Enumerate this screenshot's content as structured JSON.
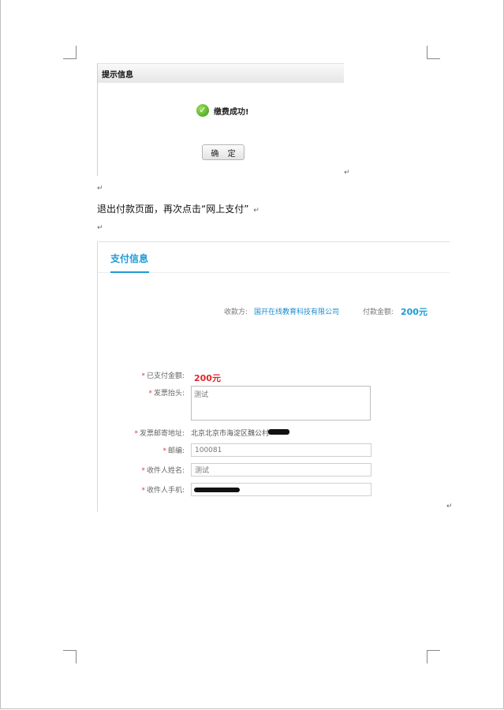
{
  "dialog": {
    "title": "提示信息",
    "message": "缴费成功!",
    "ok_label": "确 定"
  },
  "instruction_text": "退出付款页面，再次点击“网上支付”",
  "paragraph_mark": "↵",
  "payment": {
    "tab_title": "支付信息",
    "payee_label": "收款方:",
    "payee_value": "国开在线教育科技有限公司",
    "amount_label": "付款金额:",
    "amount_value": "200元",
    "required_mark": "*",
    "form": {
      "paid_label": "已支付金额:",
      "paid_value": "200元",
      "invoice_title_label": "发票抬头:",
      "invoice_title_value": "测试",
      "mail_address_label": "发票邮寄地址:",
      "mail_address_value": "北京北京市海淀区魏公村",
      "postcode_label": "邮编:",
      "postcode_value": "100081",
      "recipient_name_label": "收件人姓名:",
      "recipient_name_value": "测试",
      "recipient_phone_label": "收件人手机:"
    }
  },
  "colors": {
    "accent": "#1b9bd7",
    "amount_red": "#e2262b",
    "success_green": "#3b9a17"
  }
}
